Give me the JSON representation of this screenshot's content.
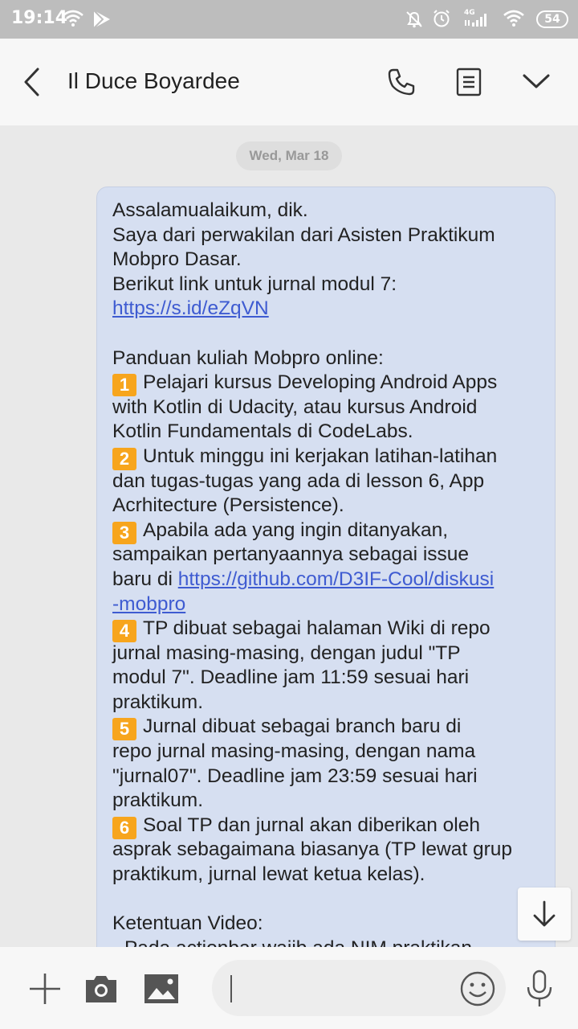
{
  "status_bar": {
    "time": "19:14",
    "network": "4G",
    "battery": "54"
  },
  "header": {
    "contact_name": "Il Duce Boyardee",
    "icons": [
      "back-arrow-icon",
      "phone-icon",
      "details-icon",
      "chevron-down-icon"
    ]
  },
  "chat": {
    "date_label": "Wed, Mar 18",
    "message": {
      "line_01": "Assalamualaikum, dik.",
      "line_02": "Saya dari perwakilan dari Asisten Praktikum",
      "line_03": "Mobpro Dasar.",
      "line_04": "Berikut link untuk jurnal modul 7:",
      "link_1": "https://s.id/eZqVN",
      "line_06": "Panduan kuliah Mobpro online:",
      "n1": "1",
      "line_07": "Pelajari kursus Developing Android Apps",
      "line_08": "with Kotlin di Udacity, atau kursus Android",
      "line_09": "Kotlin Fundamentals di CodeLabs.",
      "n2": "2",
      "line_10": "Untuk minggu ini kerjakan latihan-latihan",
      "line_11": "dan tugas-tugas yang ada di lesson 6, App",
      "line_12": "Acrhitecture (Persistence).",
      "n3": "3",
      "line_13": "Apabila ada yang ingin ditanyakan,",
      "line_14": "sampaikan pertanyaannya sebagai issue",
      "line_15_prefix": "baru di ",
      "link_2a": "https://github.com/D3IF-Cool/diskusi",
      "link_2b": "-mobpro",
      "n4": "4",
      "line_17": "TP dibuat sebagai halaman Wiki di repo",
      "line_18": "jurnal masing-masing, dengan judul \"TP",
      "line_19": "modul 7\". Deadline jam 11:59 sesuai hari",
      "line_20": "praktikum.",
      "n5": "5",
      "line_21": "Jurnal dibuat sebagai branch baru di",
      "line_22": "repo jurnal masing-masing, dengan nama",
      "line_23": "\"jurnal07\". Deadline jam 23:59 sesuai hari",
      "line_24": "praktikum.",
      "n6": "6",
      "line_25": "Soal TP dan jurnal akan diberikan oleh",
      "line_26": "asprak sebagaimana biasanya (TP lewat grup",
      "line_27": "praktikum, jurnal lewat ketua kelas).",
      "line_29": "Ketentuan Video:",
      "line_30": "- Pada actionbar wajib ada NIM praktikan"
    }
  },
  "composer": {
    "input_value": "",
    "icons": [
      "plus-icon",
      "camera-icon",
      "gallery-icon",
      "emoji-icon",
      "microphone-icon"
    ]
  }
}
